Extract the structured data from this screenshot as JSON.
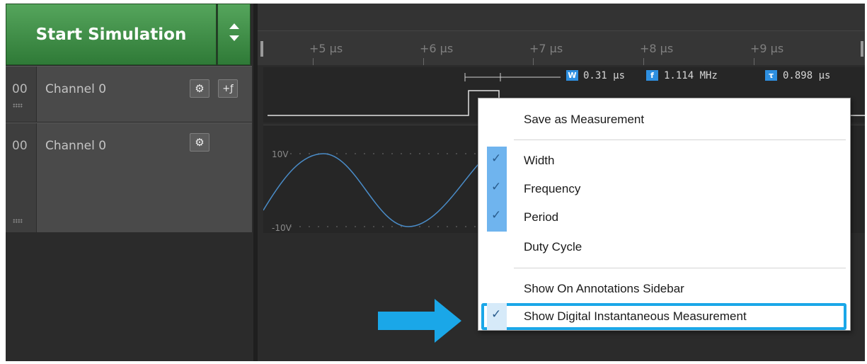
{
  "toolbar": {
    "start_label": "Start Simulation"
  },
  "ruler": {
    "ticks": [
      "+5 µs",
      "+6 µs",
      "+7 µs",
      "+8 µs",
      "+9 µs"
    ]
  },
  "channels": [
    {
      "index": "00",
      "name": "Channel 0",
      "type": "digital"
    },
    {
      "index": "00",
      "name": "Channel 0",
      "type": "analog"
    }
  ],
  "measurement": {
    "width_icon": "W",
    "width": "0.31 µs",
    "freq_icon": "f",
    "frequency": "1.114 MHz",
    "period_icon": "τ",
    "period": "0.898 µs"
  },
  "analog": {
    "top_label": "10V",
    "bottom_label": "-10V"
  },
  "context_menu": {
    "items": [
      {
        "label": "Save as Measurement",
        "checked": false
      },
      {
        "label": "Width",
        "checked": true
      },
      {
        "label": "Frequency",
        "checked": true
      },
      {
        "label": "Period",
        "checked": true
      },
      {
        "label": "Duty Cycle",
        "checked": false
      },
      {
        "label": "Show On Annotations Sidebar",
        "checked": false
      },
      {
        "label": "Show Digital Instantaneous Measurement",
        "checked": true,
        "highlighted": true
      }
    ]
  },
  "colors": {
    "accent": "#1aa7e8",
    "check_bg": "#6fb4ee",
    "green": "#3f8f46",
    "signal": "#e0e0e0",
    "analog_line": "#4a8cc8"
  },
  "icons": [
    "gear-icon",
    "edge-trigger-icon",
    "chevron-up-icon",
    "chevron-down-icon",
    "checkmark-icon",
    "arrow-right-icon"
  ]
}
